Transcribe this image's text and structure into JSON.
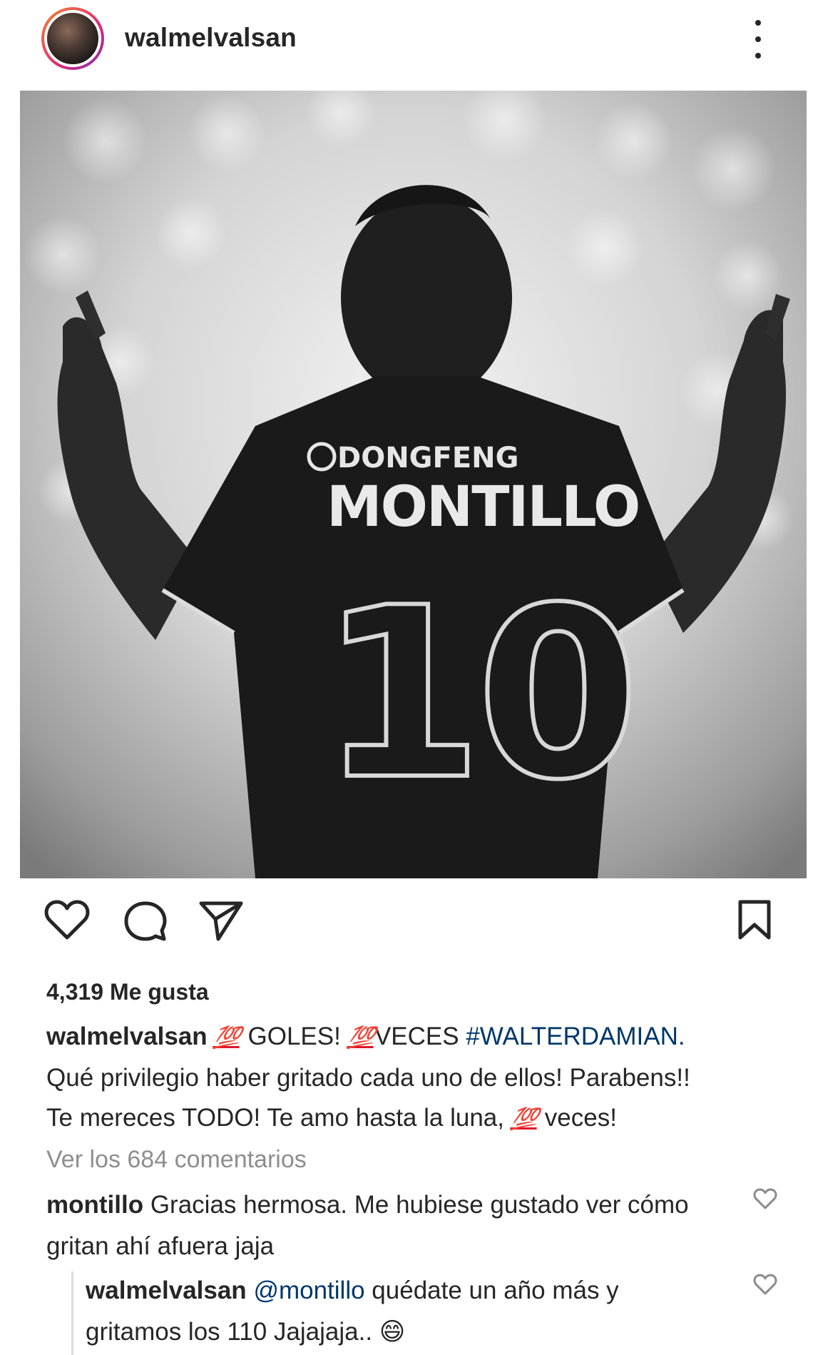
{
  "post": {
    "username": "walmelvalsan",
    "more_icon": "more-vertical-icon"
  },
  "photo": {
    "jersey_sponsor": "DONGFENG",
    "jersey_name": "MONTILLO",
    "jersey_number": "10"
  },
  "actions": {
    "like_icon": "heart-icon",
    "comment_icon": "comment-icon",
    "share_icon": "send-icon",
    "save_icon": "bookmark-icon"
  },
  "likes_text": "4,319 Me gusta",
  "caption": {
    "username": "walmelvalsan",
    "emoji_100": "💯",
    "part1": " GOLES! ",
    "part2": "VECES ",
    "hashtag": "#WALTERDAMIAN.",
    "line2": "Qué privilegio haber gritado cada uno de ellos! Parabens!!",
    "line3a": "Te mereces TODO! Te amo hasta la luna, ",
    "line3b": " veces!"
  },
  "view_comments": "Ver los 684 comentarios",
  "comments": [
    {
      "username": "montillo",
      "text": " Gracias hermosa. Me hubiese gustado ver cómo gritan ahí afuera jaja"
    }
  ],
  "reply": {
    "username": "walmelvalsan",
    "mention": "@montillo",
    "text": " quédate un año más y gritamos los 110 Jajajaja.. 😄"
  }
}
